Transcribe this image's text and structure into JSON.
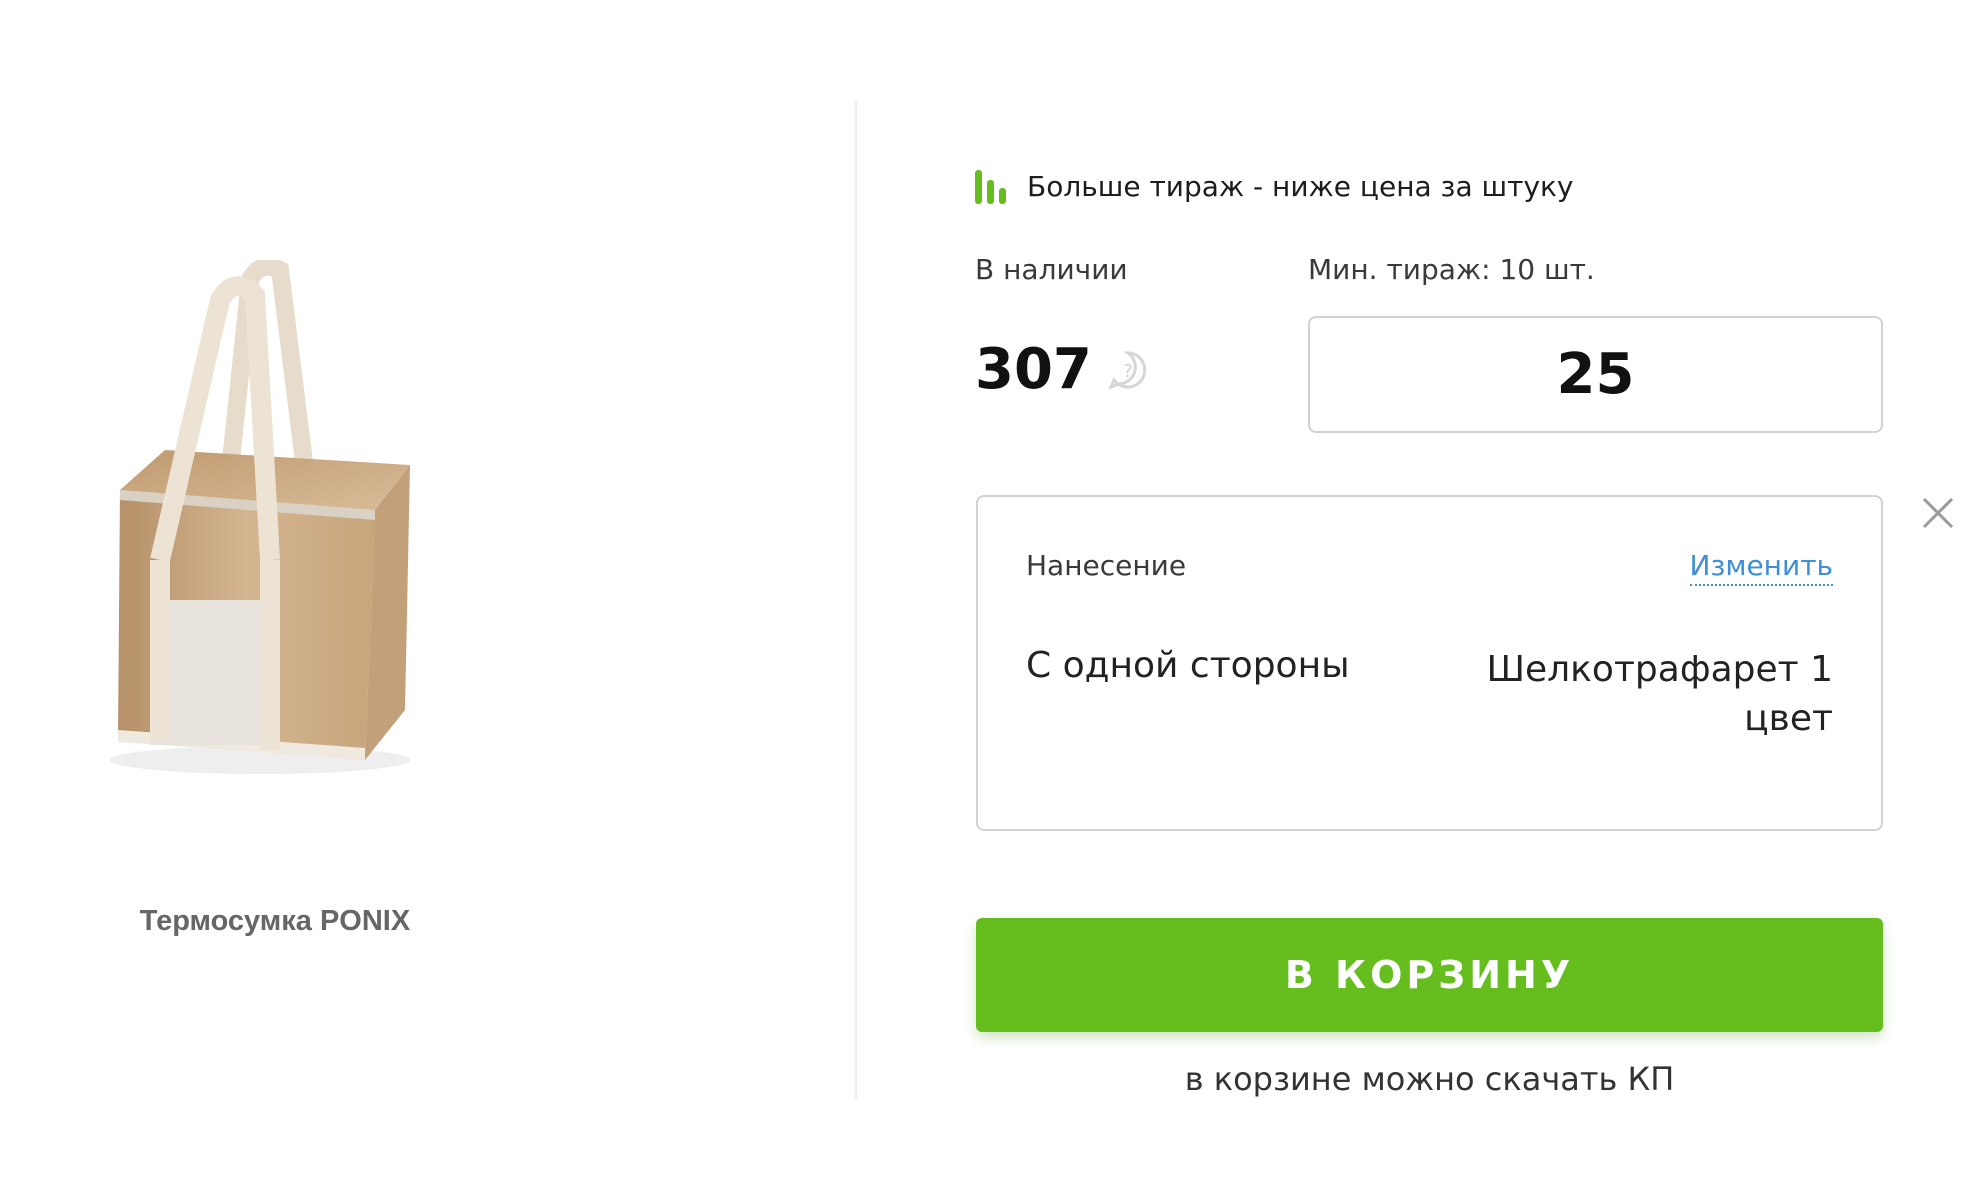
{
  "product": {
    "name": "Термосумка PONIX",
    "image_icon": "jute-cooler-bag-image"
  },
  "promo": {
    "icon": "bar-chart-icon",
    "text": "Больше тираж - ниже цена за штуку",
    "icon_color": "#65be1e"
  },
  "stock": {
    "label": "В наличии",
    "value": "307",
    "help_icon": "question-mark-icon"
  },
  "quantity": {
    "min_label": "Мин. тираж: 10 шт.",
    "value": "25"
  },
  "printing": {
    "title": "Нанесение",
    "change_label": "Изменить",
    "side": "С одной стороны",
    "method": "Шелкотрафарет 1 цвет",
    "close_icon": "close-icon"
  },
  "cart": {
    "button_label": "В КОРЗИНУ",
    "note": "в корзине можно скачать КП",
    "accent_color": "#65be1e"
  }
}
